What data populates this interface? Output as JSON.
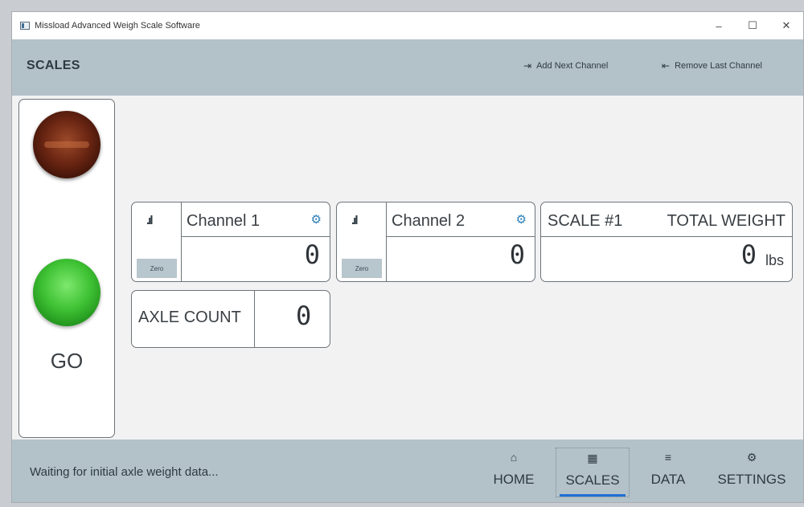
{
  "window": {
    "title": "Missload Advanced Weigh Scale Software",
    "minimize": "–",
    "maximize": "☐",
    "close": "✕"
  },
  "header": {
    "title": "SCALES",
    "add_channel": {
      "icon": "add-channel-icon",
      "label": "Add Next Channel"
    },
    "remove_channel": {
      "icon": "remove-channel-icon",
      "label": "Remove Last Channel"
    }
  },
  "lights": {
    "red": "off",
    "green": "on",
    "status_label": "GO"
  },
  "channels": [
    {
      "name": "Channel 1",
      "value": "0",
      "zero_label": "Zero",
      "signal_icon": "signal-icon",
      "settings_icon": "gear-icon"
    },
    {
      "name": "Channel 2",
      "value": "0",
      "zero_label": "Zero",
      "signal_icon": "signal-icon",
      "settings_icon": "gear-icon"
    }
  ],
  "scale": {
    "name": "SCALE #1",
    "total_label": "TOTAL WEIGHT",
    "value": "0",
    "unit": "lbs"
  },
  "axle": {
    "label": "AXLE COUNT",
    "value": "0"
  },
  "footer": {
    "status": "Waiting for initial axle weight data...",
    "nav": [
      {
        "label": "HOME",
        "icon": "home-icon"
      },
      {
        "label": "SCALES",
        "icon": "grid-icon",
        "active": true
      },
      {
        "label": "DATA",
        "icon": "database-icon"
      },
      {
        "label": "SETTINGS",
        "icon": "settings-gear-icon"
      }
    ]
  },
  "colors": {
    "header_bg": "#b3c1c9",
    "accent": "#1f6fd1",
    "green_light": "#3fc234",
    "red_light": "#6a2512"
  }
}
